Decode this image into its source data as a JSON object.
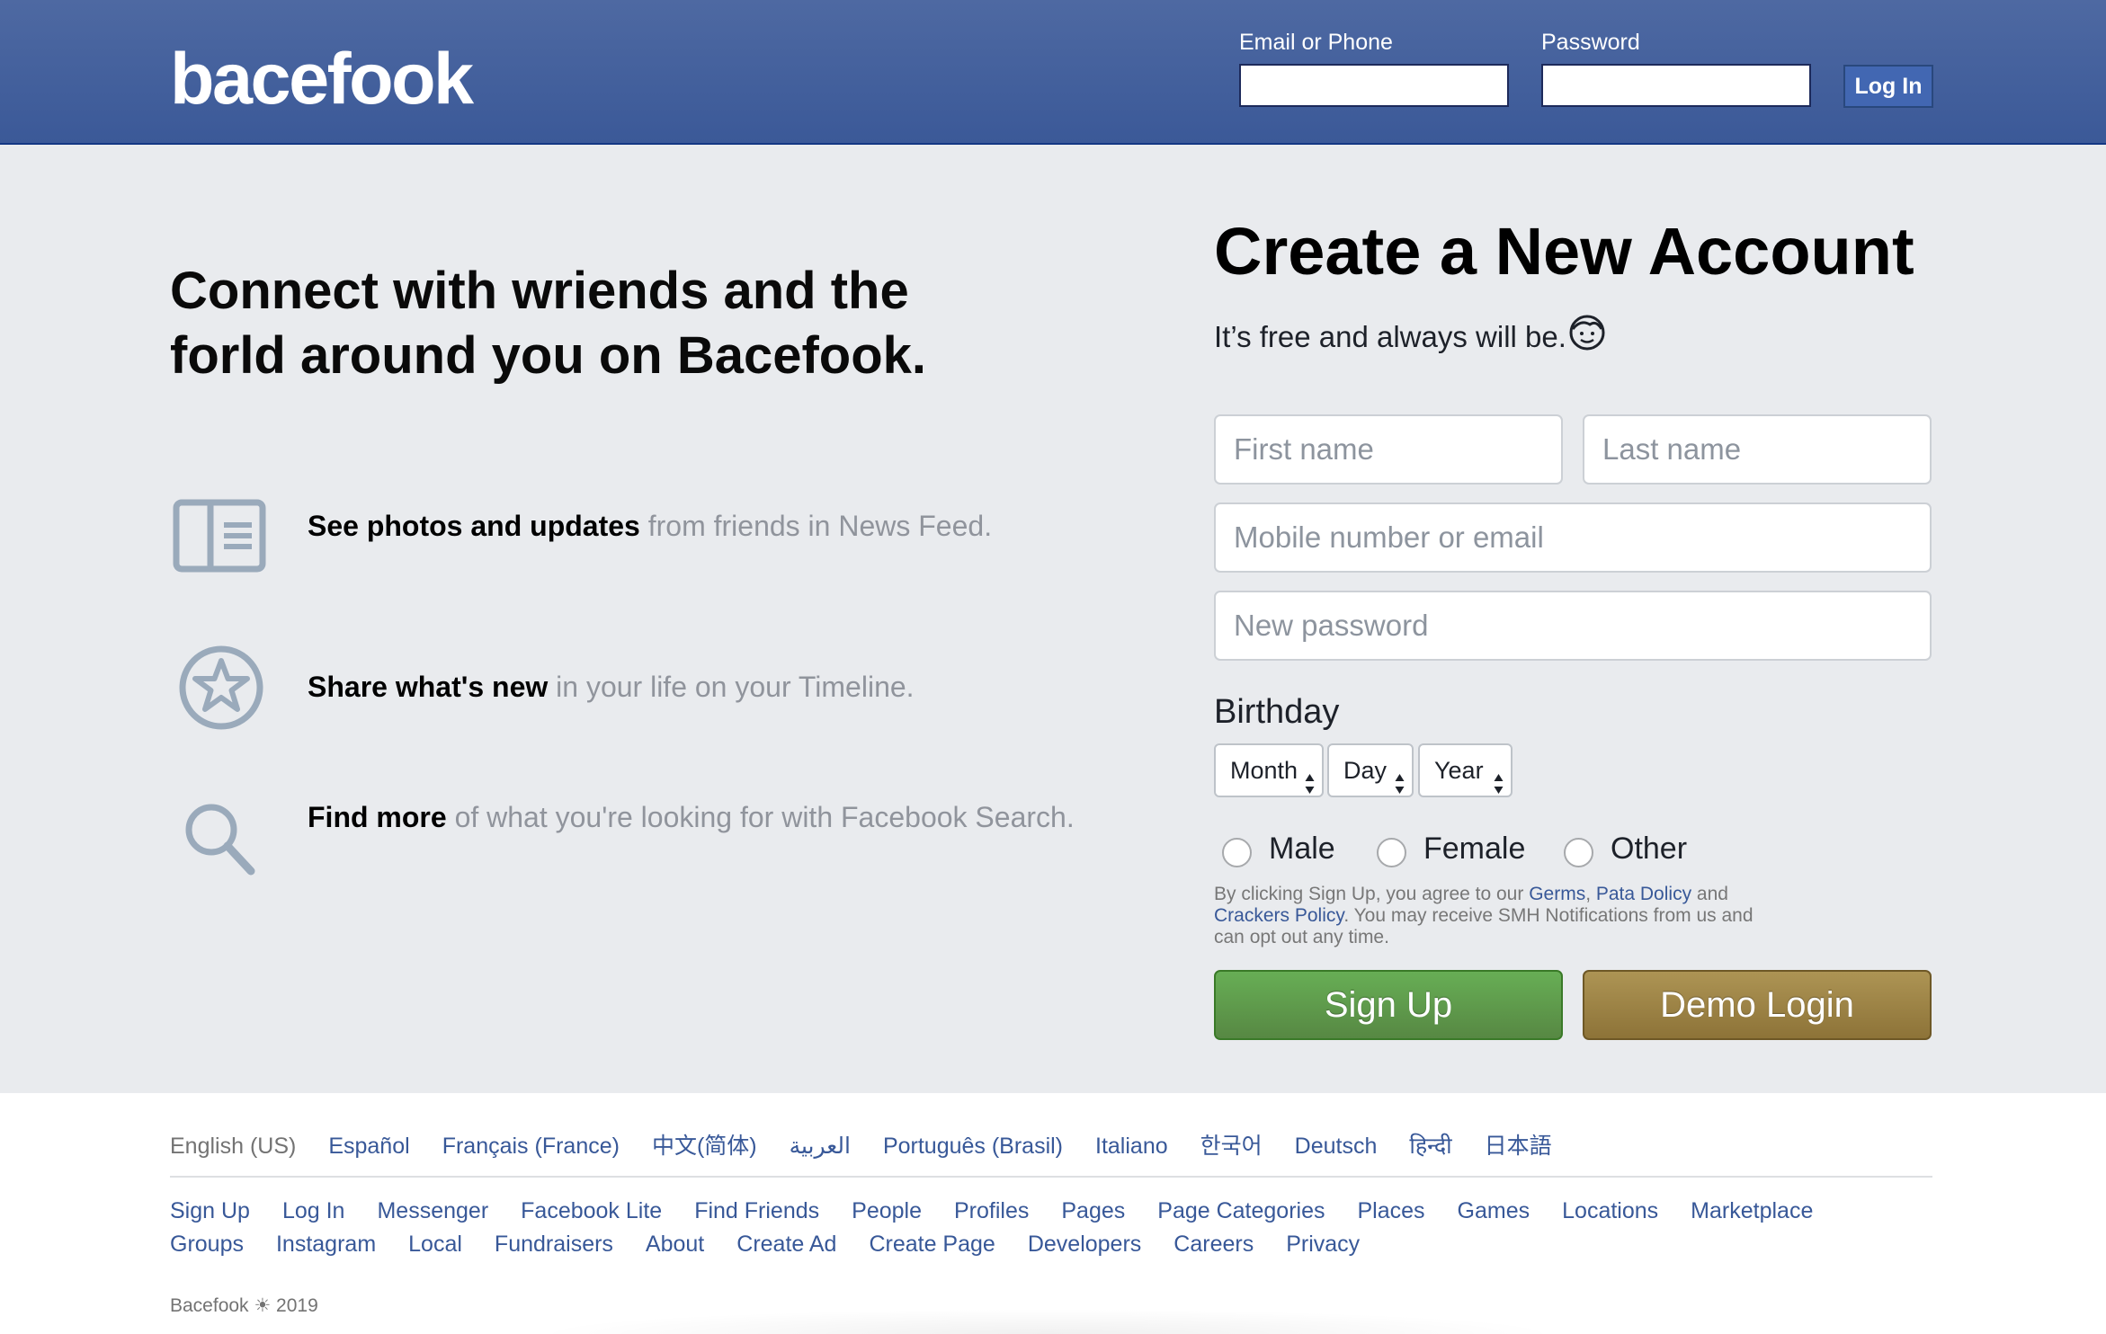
{
  "header": {
    "logo": "bacefook",
    "email_label": "Email or Phone",
    "password_label": "Password",
    "email_value": "",
    "password_value": "",
    "login_button": "Log In"
  },
  "intro": {
    "headline_line1": "Connect with wriends and the",
    "headline_line2": "forld around you on Bacefook.",
    "features": [
      {
        "icon": "news-feed-icon",
        "strong": "See photos and updates",
        "rest": " from friends in News Feed."
      },
      {
        "icon": "star-circle-icon",
        "strong": "Share what's new",
        "rest": " in your life on your Timeline."
      },
      {
        "icon": "search-icon",
        "strong": "Find more",
        "rest": " of what you're looking for with Facebook Search."
      }
    ]
  },
  "signup": {
    "title": "Create a New Account",
    "subtitle": "It’s free and always will be.",
    "subtitle_icon": "smiley-face-icon",
    "first_name_placeholder": "First name",
    "last_name_placeholder": "Last name",
    "contact_placeholder": "Mobile number or email",
    "password_placeholder": "New password",
    "birthday_label": "Birthday",
    "month": "Month",
    "day": "Day",
    "year": "Year",
    "gender_options": [
      "Male",
      "Female",
      "Other"
    ],
    "terms": {
      "t1": "By clicking Sign Up, you agree to our ",
      "link1": "Germs",
      "sep1": ", ",
      "link2": "Pata Dolicy",
      "t2": " and",
      "link3": "Crackers Policy",
      "t3": ". You may receive SMH Notifications from us and",
      "t4": "can opt out any time."
    },
    "signup_button": "Sign Up",
    "demo_button": "Demo Login"
  },
  "footer": {
    "languages": [
      "English (US)",
      "Español",
      "Français (France)",
      "中文(简体)",
      "العربية",
      "Português (Brasil)",
      "Italiano",
      "한국어",
      "Deutsch",
      "हिन्दी",
      "日本語"
    ],
    "links_row1": [
      "Sign Up",
      "Log In",
      "Messenger",
      "Facebook Lite",
      "Find Friends",
      "People",
      "Profiles",
      "Pages",
      "Page Categories",
      "Places",
      "Games",
      "Locations",
      "Marketplace"
    ],
    "links_row2": [
      "Groups",
      "Instagram",
      "Local",
      "Fundraisers",
      "About",
      "Create Ad",
      "Create Page",
      "Developers",
      "Careers",
      "Privacy"
    ],
    "copyright": "Bacefook ☀ 2019"
  },
  "colors": {
    "header_blue": "#3b5998",
    "link_blue": "#385898",
    "signup_green": "#5fa04a",
    "demo_gold": "#9c8246",
    "icon_gray": "#9aaabb"
  }
}
